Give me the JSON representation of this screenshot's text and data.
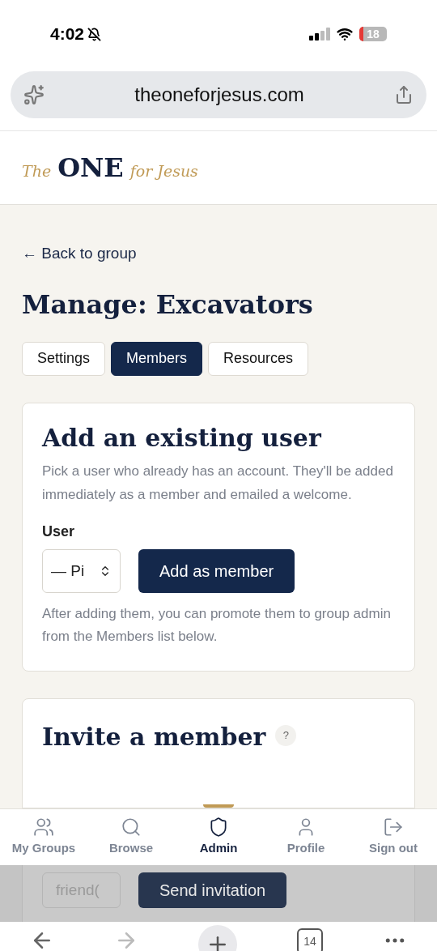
{
  "status_bar": {
    "time": "4:02",
    "battery": "18"
  },
  "browser": {
    "url": "theoneforjesus.com",
    "tab_count": "14"
  },
  "logo": {
    "prefix": "The",
    "main": "ONE",
    "suffix": "for Jesus"
  },
  "back_link": "← Back to group",
  "page_title": "Manage: Excavators",
  "tabs": [
    {
      "label": "Settings",
      "selected": false
    },
    {
      "label": "Members",
      "selected": true
    },
    {
      "label": "Resources",
      "selected": false
    }
  ],
  "add_card": {
    "title": "Add an existing user",
    "description": "Pick a user who already has an account. They'll be added immediately as a member and emailed a welcome.",
    "field_label": "User",
    "select_value": "— Pi",
    "button": "Add as member",
    "note": "After adding them, you can promote them to group admin from the Members list below."
  },
  "invite_card": {
    "title": "Invite a member",
    "help": "?",
    "email_placeholder": "friend(",
    "button": "Send invitation"
  },
  "bottom_nav": [
    {
      "label": "My Groups",
      "selected": false
    },
    {
      "label": "Browse",
      "selected": false
    },
    {
      "label": "Admin",
      "selected": true
    },
    {
      "label": "Profile",
      "selected": false
    },
    {
      "label": "Sign out",
      "selected": false
    }
  ]
}
